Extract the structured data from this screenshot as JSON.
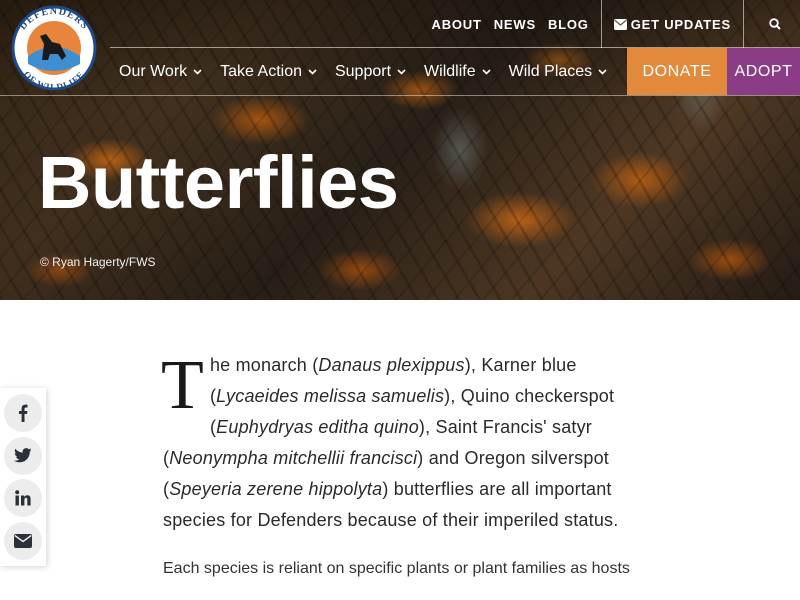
{
  "hero": {
    "title": "Butterflies",
    "credit": "© Ryan Hagerty/FWS"
  },
  "logo": {
    "top_text": "DEFENDERS",
    "bottom_text": "OF WILDLIFE",
    "colors": {
      "ring": "#1e4a8a",
      "sky": "#e8853c",
      "sun": "#f4b04a",
      "wolf": "#1a1a1a"
    }
  },
  "utility_nav": {
    "about": "ABOUT",
    "news": "NEWS",
    "blog": "BLOG",
    "updates": "GET UPDATES",
    "updates_icon": "envelope-icon",
    "search_icon": "search-icon"
  },
  "main_nav": [
    {
      "label": "Our Work"
    },
    {
      "label": "Take Action"
    },
    {
      "label": "Support"
    },
    {
      "label": "Wildlife"
    },
    {
      "label": "Wild Places"
    }
  ],
  "cta": {
    "donate": "DONATE",
    "adopt": "ADOPT",
    "donate_color": "#e2893b",
    "adopt_color": "#8a3d86"
  },
  "share": {
    "icons": [
      "facebook-icon",
      "twitter-icon",
      "linkedin-icon",
      "email-icon"
    ]
  },
  "article": {
    "dropcap": "T",
    "lead": {
      "p1": "he monarch (",
      "s1": "Danaus plexippus",
      "p2": "), Karner blue (",
      "s2": "Lycaeides melissa samuelis",
      "p3": "), Quino checkerspot (",
      "s3": "Euphydryas editha quino",
      "p4": "), Saint Francis' satyr (",
      "s4": "Neonympha mitchellii francisci",
      "p5": ") and Oregon silverspot (",
      "s5": "Speyeria zerene hippolyta",
      "p6": ") butterflies are all important species for Defenders because of their imperiled status."
    },
    "paragraph2": "Each species is reliant on specific plants or plant families as hosts"
  }
}
